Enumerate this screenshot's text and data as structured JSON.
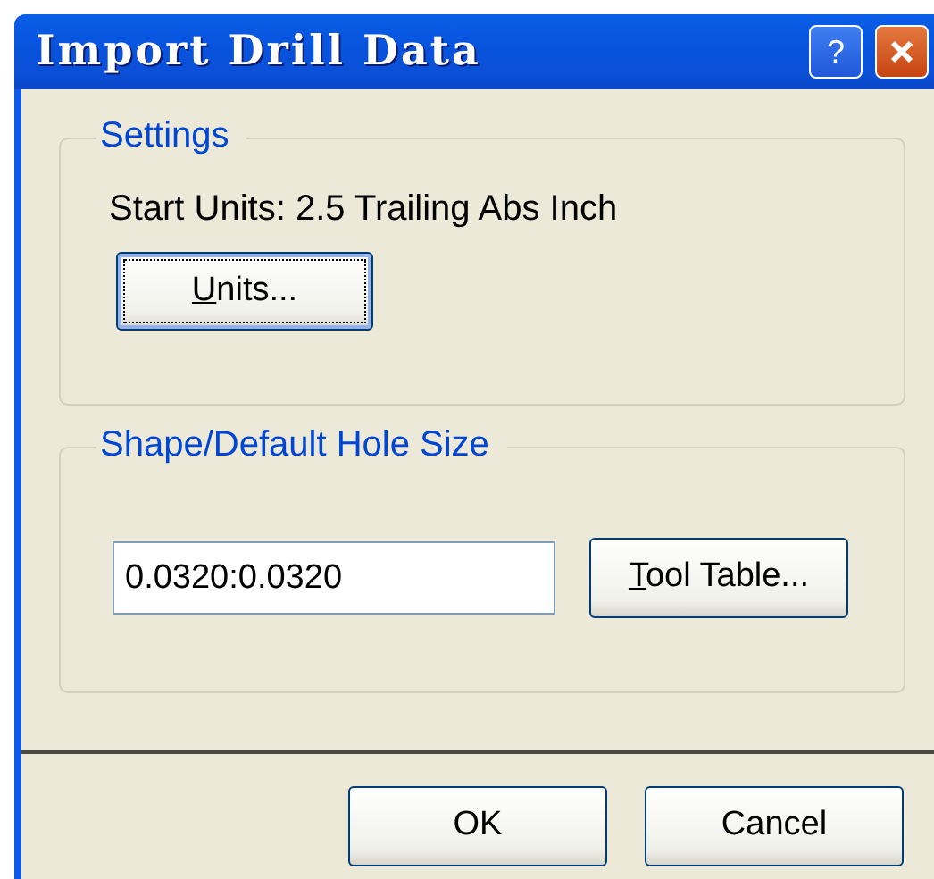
{
  "window": {
    "title": "Import Drill Data",
    "title_buttons": [
      {
        "kind": "help",
        "label": "?"
      },
      {
        "kind": "close"
      }
    ]
  },
  "groups": [
    {
      "legend": "Settings",
      "text": "Start Units: 2.5 Trailing Abs Inch",
      "button": {
        "label": "Units...",
        "underline_first": true,
        "focused": true
      }
    },
    {
      "legend": "Shape/Default Hole Size",
      "field": {
        "value": "0.0320:0.0320"
      },
      "button": {
        "label": "Tool Table...",
        "underline_first": true,
        "focused": false
      }
    }
  ],
  "buttons": [
    {
      "label": "OK"
    },
    {
      "label": "Cancel"
    }
  ]
}
